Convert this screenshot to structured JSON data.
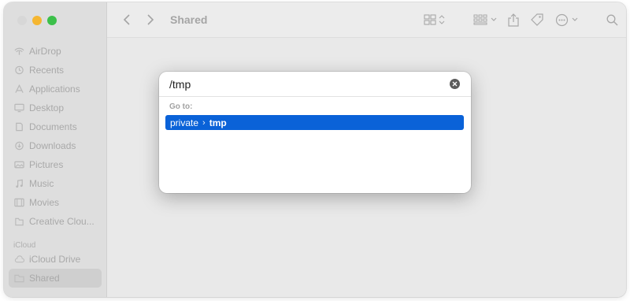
{
  "window": {
    "title": "Shared"
  },
  "sidebar": {
    "favorites": [
      {
        "label": "AirDrop",
        "icon": "airdrop-icon"
      },
      {
        "label": "Recents",
        "icon": "clock-icon"
      },
      {
        "label": "Applications",
        "icon": "applications-icon"
      },
      {
        "label": "Desktop",
        "icon": "desktop-icon"
      },
      {
        "label": "Documents",
        "icon": "document-icon"
      },
      {
        "label": "Downloads",
        "icon": "download-icon"
      },
      {
        "label": "Pictures",
        "icon": "pictures-icon"
      },
      {
        "label": "Music",
        "icon": "music-icon"
      },
      {
        "label": "Movies",
        "icon": "movies-icon"
      },
      {
        "label": "Creative Clou...",
        "icon": "creative-cloud-icon"
      }
    ],
    "icloud_header": "iCloud",
    "icloud": [
      {
        "label": "iCloud Drive",
        "icon": "cloud-icon"
      },
      {
        "label": "Shared",
        "icon": "shared-folder-icon",
        "selected": true
      }
    ]
  },
  "goto_dialog": {
    "input_value": "/tmp",
    "section_label": "Go to:",
    "result": {
      "parent": "private",
      "separator": "›",
      "target": "tmp"
    }
  },
  "colors": {
    "highlight": "#0a62d8",
    "minimize": "#f5b631",
    "zoom": "#3cc04a"
  }
}
